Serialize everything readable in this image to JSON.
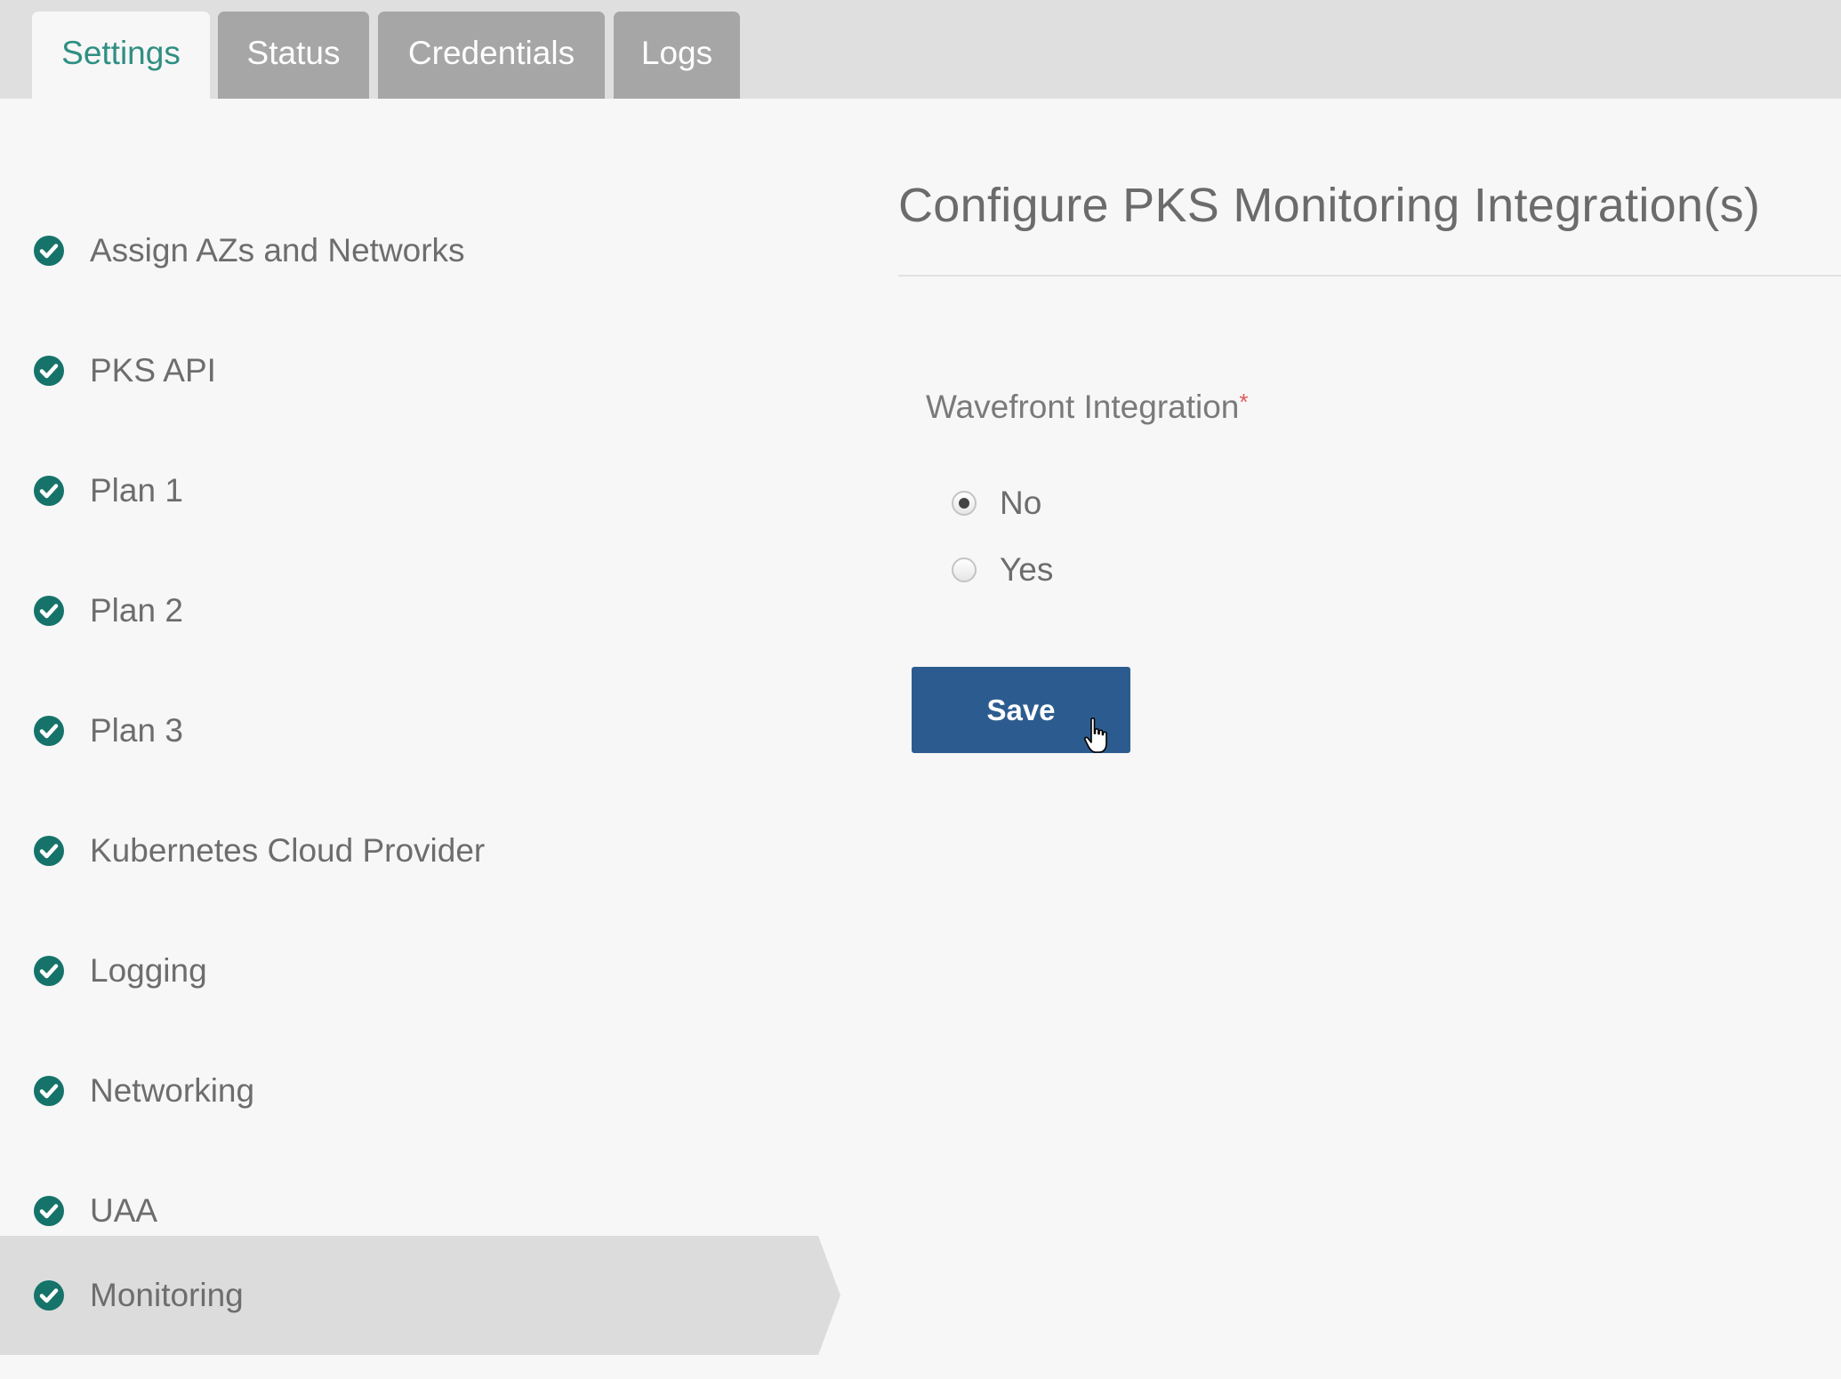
{
  "tabs": [
    {
      "label": "Settings",
      "active": true
    },
    {
      "label": "Status",
      "active": false
    },
    {
      "label": "Credentials",
      "active": false
    },
    {
      "label": "Logs",
      "active": false
    }
  ],
  "sidebar": {
    "items": [
      {
        "label": "Assign AZs and Networks",
        "icon": "check-circle-icon",
        "active": false
      },
      {
        "label": "PKS API",
        "icon": "check-circle-icon",
        "active": false
      },
      {
        "label": "Plan 1",
        "icon": "check-circle-icon",
        "active": false
      },
      {
        "label": "Plan 2",
        "icon": "check-circle-icon",
        "active": false
      },
      {
        "label": "Plan 3",
        "icon": "check-circle-icon",
        "active": false
      },
      {
        "label": "Kubernetes Cloud Provider",
        "icon": "check-circle-icon",
        "active": false
      },
      {
        "label": "Logging",
        "icon": "check-circle-icon",
        "active": false
      },
      {
        "label": "Networking",
        "icon": "check-circle-icon",
        "active": false
      },
      {
        "label": "UAA",
        "icon": "check-circle-icon",
        "active": false
      },
      {
        "label": "Monitoring",
        "icon": "check-circle-icon",
        "active": true
      }
    ]
  },
  "main": {
    "title": "Configure PKS Monitoring Integration(s)",
    "field_label": "Wavefront Integration",
    "required_mark": "*",
    "options": [
      {
        "label": "No",
        "selected": true
      },
      {
        "label": "Yes",
        "selected": false
      }
    ],
    "save_label": "Save"
  },
  "colors": {
    "tab_bar_bg": "#dfdfdf",
    "tab_inactive_bg": "#a6a6a6",
    "tab_active_text": "#2f8f82",
    "check_icon": "#15736a",
    "save_button": "#2c5c8f",
    "required": "#e05b5b",
    "active_sidebar_bg": "#dcdcdc"
  }
}
